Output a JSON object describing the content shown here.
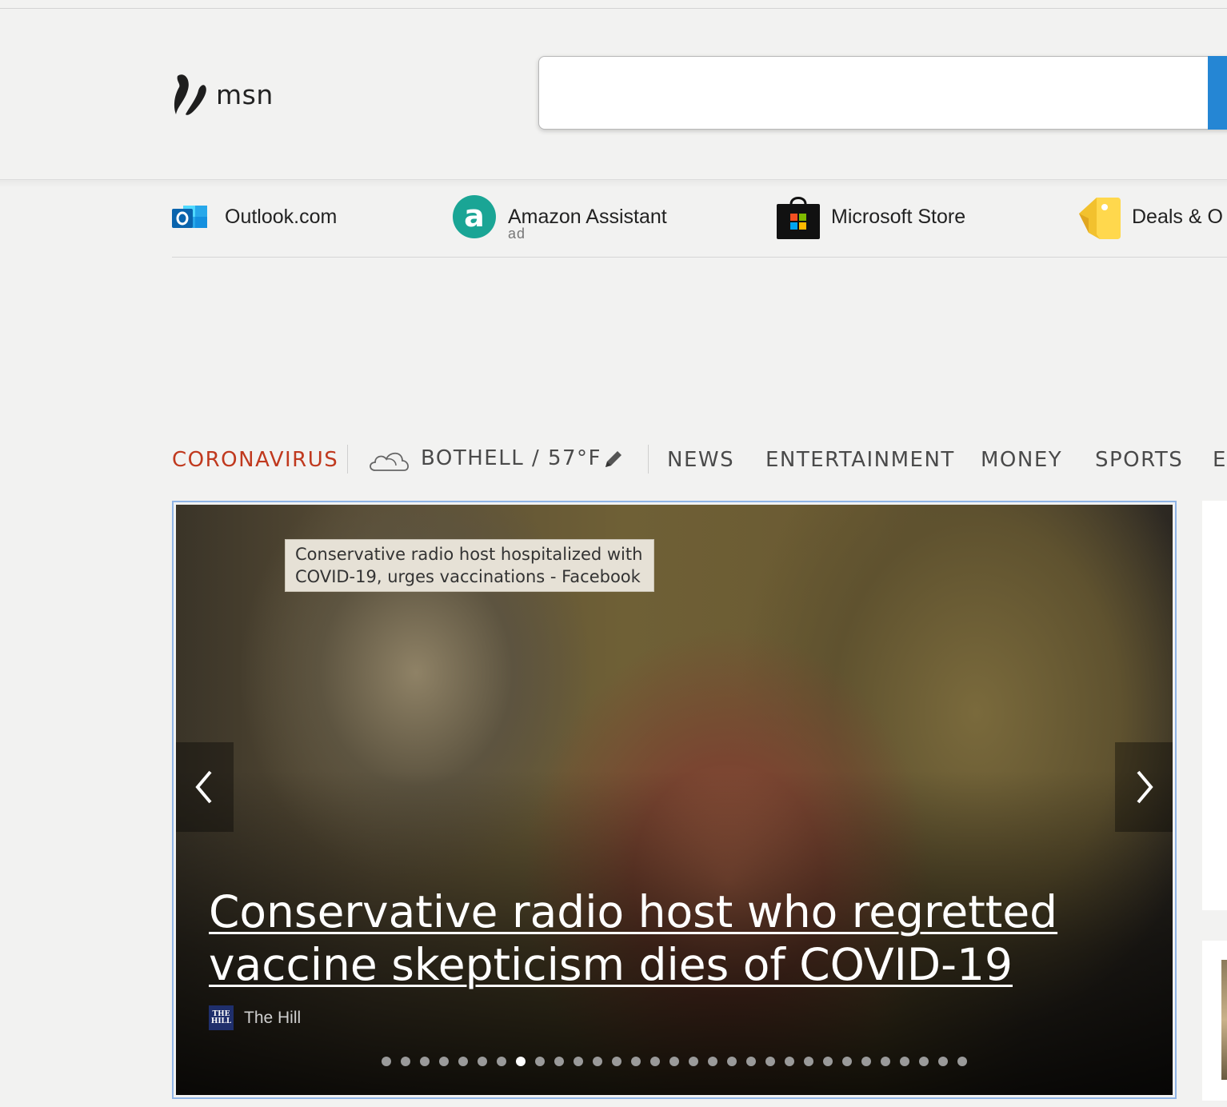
{
  "brand": {
    "logo_text": "msn"
  },
  "search": {
    "value": "",
    "placeholder": ""
  },
  "quick_links": [
    {
      "label": "Outlook.com",
      "icon": "outlook-icon",
      "sub": ""
    },
    {
      "label": "Amazon Assistant",
      "icon": "amazon-icon",
      "sub": "ad"
    },
    {
      "label": "Microsoft Store",
      "icon": "microsoft-store-icon",
      "sub": ""
    },
    {
      "label": "Deals & O",
      "icon": "deals-tag-icon",
      "sub": ""
    }
  ],
  "nav": {
    "coronavirus": "CORONAVIRUS",
    "weather": "BOTHELL / 57°F",
    "items": [
      "NEWS",
      "ENTERTAINMENT",
      "MONEY",
      "SPORTS",
      "E"
    ]
  },
  "hero": {
    "tooltip_line1": "Conservative radio host hospitalized with",
    "tooltip_line2": "COVID-19, urges vaccinations - Facebook",
    "title": "Conservative radio host who regretted vaccine skepticism dies of COVID-19",
    "source": "The Hill",
    "source_logo_text": "THE HILL",
    "dot_count": 31,
    "active_dot": 7
  },
  "colors": {
    "accent_red": "#c0391e",
    "search_button": "#2586d4",
    "nav_text": "#4a4a4a"
  }
}
